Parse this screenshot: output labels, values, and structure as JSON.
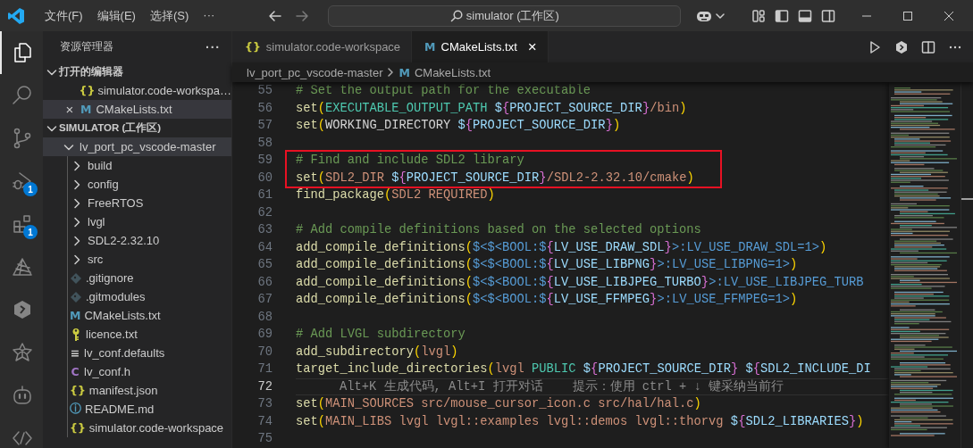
{
  "title_bar": {
    "menu": [
      "文件(F)",
      "编辑(E)",
      "选择(S)",
      "···"
    ],
    "search": {
      "text": "simulator (工作区)"
    }
  },
  "activity_bar": [
    {
      "selected": true
    },
    {
      "selected": false
    },
    {
      "selected": false
    },
    {
      "selected": false,
      "badge": "1"
    },
    {
      "selected": false,
      "badge": "1"
    },
    {
      "selected": false
    },
    {
      "selected": false
    },
    {
      "selected": false
    },
    {
      "selected": false
    },
    {
      "selected": false
    }
  ],
  "explorer": {
    "title": "资源管理器",
    "more": "···",
    "open_editors": {
      "title": "打开的编辑器",
      "expanded": true,
      "items": [
        {
          "glyph": "{}",
          "color": "#cbcb41",
          "label": "simulator.code-workspa…",
          "selected": false
        },
        {
          "close": "×",
          "glyph": "M",
          "color": "#519aba",
          "label": "CMakeLists.txt",
          "selected": true
        }
      ]
    },
    "workspace": {
      "title": "SIMULATOR (工作区)",
      "expanded": true,
      "tree": [
        {
          "kind": "folder",
          "label": "lv_port_pc_vscode-master",
          "expanded": true,
          "highlighted": true,
          "children": [
            {
              "kind": "folder",
              "label": "build",
              "expanded": false,
              "highlighted": false
            },
            {
              "kind": "folder",
              "label": "config",
              "expanded": false,
              "highlighted": false
            },
            {
              "kind": "folder",
              "label": "FreeRTOS",
              "expanded": false,
              "highlighted": false
            },
            {
              "kind": "folder",
              "label": "lvgl",
              "expanded": false,
              "highlighted": false
            },
            {
              "kind": "folder",
              "label": "SDL2-2.32.10",
              "expanded": false,
              "highlighted": false
            },
            {
              "kind": "folder",
              "label": "src",
              "expanded": false,
              "highlighted": false
            },
            {
              "kind": "git_file",
              "label": ".gitignore",
              "highlighted": false
            },
            {
              "kind": "git_file",
              "label": ".gitmodules",
              "highlighted": false
            },
            {
              "kind": "file",
              "glyph": "M",
              "color": "#519aba",
              "label": "CMakeLists.txt",
              "highlighted": false
            },
            {
              "kind": "key_file",
              "label": "licence.txt",
              "highlighted": false
            },
            {
              "kind": "file",
              "glyph": "≡",
              "color": "#cccccc",
              "label": "lv_conf.defaults",
              "highlighted": false
            },
            {
              "kind": "file",
              "glyph": "C",
              "color": "#a074c4",
              "label": "lv_conf.h",
              "highlighted": false
            },
            {
              "kind": "file",
              "glyph": "{}",
              "color": "#cbcb41",
              "label": "manifest.json",
              "highlighted": false
            },
            {
              "kind": "file",
              "glyph": "ⓘ",
              "color": "#519aba",
              "label": "README.md",
              "highlighted": false
            },
            {
              "kind": "file",
              "glyph": "{}",
              "color": "#cbcb41",
              "label": "simulator.code-workspace",
              "highlighted": false
            }
          ]
        }
      ]
    }
  },
  "tabs": [
    {
      "glyph": "{}",
      "color": "#cbcb41",
      "label": "simulator.code-workspace",
      "selected": false
    },
    {
      "glyph": "M",
      "color": "#519aba",
      "label": "CMakeLists.txt",
      "selected": true,
      "close": "×"
    }
  ],
  "breadcrumbs": {
    "folder": "lv_port_pc_vscode-master",
    "file": {
      "glyph": "M",
      "color": "#519aba",
      "label": "CMakeLists.txt"
    }
  },
  "code": {
    "lines": [
      {
        "number": "55",
        "current": false,
        "boxed": false,
        "tokens": [
          {
            "kind": "comment",
            "text": "# Set the output path for the executable"
          }
        ]
      },
      {
        "number": "56",
        "current": false,
        "boxed": false,
        "tokens": [
          {
            "kind": "func",
            "text": "set"
          },
          {
            "kind": "paren",
            "text": "("
          },
          {
            "kind": "const",
            "text": "EXECUTABLE_OUTPUT_PATH"
          },
          {
            "kind": "var",
            "text": " $"
          },
          {
            "kind": "brace",
            "text": "{"
          },
          {
            "kind": "var",
            "text": "PROJECT_SOURCE_DIR"
          },
          {
            "kind": "brace",
            "text": "}"
          },
          {
            "kind": "arg",
            "text": "/bin"
          },
          {
            "kind": "paren",
            "text": ")"
          }
        ]
      },
      {
        "number": "57",
        "current": false,
        "boxed": false,
        "tokens": [
          {
            "kind": "func",
            "text": "set"
          },
          {
            "kind": "paren",
            "text": "("
          },
          {
            "kind": "plain",
            "text": "WORKING_DIRECTORY "
          },
          {
            "kind": "var",
            "text": "$"
          },
          {
            "kind": "brace",
            "text": "{"
          },
          {
            "kind": "var",
            "text": "PROJECT_SOURCE_DIR"
          },
          {
            "kind": "brace",
            "text": "}"
          },
          {
            "kind": "paren",
            "text": ")"
          }
        ]
      },
      {
        "number": "58",
        "current": false,
        "boxed": false
      },
      {
        "number": "59",
        "current": false,
        "boxed": true,
        "tokens": [
          {
            "kind": "comment",
            "text": "# Find and include SDL2 library"
          }
        ]
      },
      {
        "number": "60",
        "current": false,
        "boxed": true,
        "tokens": [
          {
            "kind": "func",
            "text": "set"
          },
          {
            "kind": "paren",
            "text": "("
          },
          {
            "kind": "arg",
            "text": "SDL2_DIR "
          },
          {
            "kind": "var",
            "text": "$"
          },
          {
            "kind": "brace",
            "text": "{"
          },
          {
            "kind": "var",
            "text": "PROJECT_SOURCE_DIR"
          },
          {
            "kind": "brace",
            "text": "}"
          },
          {
            "kind": "arg",
            "text": "/SDL2-2.32.10/cmake"
          },
          {
            "kind": "paren",
            "text": ")"
          }
        ]
      },
      {
        "number": "61",
        "current": false,
        "boxed": false,
        "tokens": [
          {
            "kind": "func",
            "text": "find_package"
          },
          {
            "kind": "paren",
            "text": "("
          },
          {
            "kind": "arg",
            "text": "SDL2 REQUIRED"
          },
          {
            "kind": "paren",
            "text": ")"
          }
        ]
      },
      {
        "number": "62",
        "current": false,
        "boxed": false
      },
      {
        "number": "63",
        "current": false,
        "boxed": false,
        "tokens": [
          {
            "kind": "comment",
            "text": "# Add compile definitions based on the selected options"
          }
        ]
      },
      {
        "number": "64",
        "current": false,
        "boxed": false,
        "tokens": [
          {
            "kind": "func",
            "text": "add_compile_definitions"
          },
          {
            "kind": "paren",
            "text": "("
          },
          {
            "kind": "gen",
            "text": "$<$<BOOL:$"
          },
          {
            "kind": "brace",
            "text": "{"
          },
          {
            "kind": "var",
            "text": "LV_USE_DRAW_SDL"
          },
          {
            "kind": "brace",
            "text": "}"
          },
          {
            "kind": "gen",
            "text": ">:LV_USE_DRAW_SDL=1>"
          },
          {
            "kind": "paren",
            "text": ")"
          }
        ]
      },
      {
        "number": "65",
        "current": false,
        "boxed": false,
        "tokens": [
          {
            "kind": "func",
            "text": "add_compile_definitions"
          },
          {
            "kind": "paren",
            "text": "("
          },
          {
            "kind": "gen",
            "text": "$<$<BOOL:$"
          },
          {
            "kind": "brace",
            "text": "{"
          },
          {
            "kind": "var",
            "text": "LV_USE_LIBPNG"
          },
          {
            "kind": "brace",
            "text": "}"
          },
          {
            "kind": "gen",
            "text": ">:LV_USE_LIBPNG=1>"
          },
          {
            "kind": "paren",
            "text": ")"
          }
        ]
      },
      {
        "number": "66",
        "current": false,
        "boxed": false,
        "tokens": [
          {
            "kind": "func",
            "text": "add_compile_definitions"
          },
          {
            "kind": "paren",
            "text": "("
          },
          {
            "kind": "gen",
            "text": "$<$<BOOL:$"
          },
          {
            "kind": "brace",
            "text": "{"
          },
          {
            "kind": "var",
            "text": "LV_USE_LIBJPEG_TURBO"
          },
          {
            "kind": "brace",
            "text": "}"
          },
          {
            "kind": "gen",
            "text": ">:LV_USE_LIBJPEG_TURB"
          }
        ]
      },
      {
        "number": "67",
        "current": false,
        "boxed": false,
        "tokens": [
          {
            "kind": "func",
            "text": "add_compile_definitions"
          },
          {
            "kind": "paren",
            "text": "("
          },
          {
            "kind": "gen",
            "text": "$<$<BOOL:$"
          },
          {
            "kind": "brace",
            "text": "{"
          },
          {
            "kind": "var",
            "text": "LV_USE_FFMPEG"
          },
          {
            "kind": "brace",
            "text": "}"
          },
          {
            "kind": "gen",
            "text": ">:LV_USE_FFMPEG=1>"
          },
          {
            "kind": "paren",
            "text": ")"
          }
        ]
      },
      {
        "number": "68",
        "current": false,
        "boxed": false
      },
      {
        "number": "69",
        "current": false,
        "boxed": false,
        "tokens": [
          {
            "kind": "comment",
            "text": "# Add LVGL subdirectory"
          }
        ]
      },
      {
        "number": "70",
        "current": false,
        "boxed": false,
        "tokens": [
          {
            "kind": "func",
            "text": "add_subdirectory"
          },
          {
            "kind": "paren",
            "text": "("
          },
          {
            "kind": "arg",
            "text": "lvgl"
          },
          {
            "kind": "paren",
            "text": ")"
          }
        ]
      },
      {
        "number": "71",
        "current": false,
        "boxed": false,
        "tokens": [
          {
            "kind": "func",
            "text": "target_include_directories"
          },
          {
            "kind": "paren",
            "text": "("
          },
          {
            "kind": "arg",
            "text": "lvgl "
          },
          {
            "kind": "const",
            "text": "PUBLIC"
          },
          {
            "kind": "var",
            "text": " $"
          },
          {
            "kind": "brace",
            "text": "{"
          },
          {
            "kind": "var",
            "text": "PROJECT_SOURCE_DIR"
          },
          {
            "kind": "brace",
            "text": "}"
          },
          {
            "kind": "var",
            "text": " $"
          },
          {
            "kind": "brace",
            "text": "{"
          },
          {
            "kind": "var",
            "text": "SDL2_INCLUDE_DI"
          }
        ]
      },
      {
        "number": "72",
        "current": true,
        "boxed": false,
        "tokens": [
          {
            "kind": "hint",
            "text": "Alt+K 生成代码, Alt+I 打开对话    提示：使用 ctrl + ↓ 键采纳当前行"
          }
        ]
      },
      {
        "number": "73",
        "current": false,
        "boxed": false,
        "tokens": [
          {
            "kind": "func",
            "text": "set"
          },
          {
            "kind": "paren",
            "text": "("
          },
          {
            "kind": "arg",
            "text": "MAIN_SOURCES src/mouse_cursor_icon.c src/hal/hal.c"
          },
          {
            "kind": "paren",
            "text": ")"
          }
        ]
      },
      {
        "number": "74",
        "current": false,
        "boxed": false,
        "tokens": [
          {
            "kind": "func",
            "text": "set"
          },
          {
            "kind": "paren",
            "text": "("
          },
          {
            "kind": "arg",
            "text": "MAIN_LIBS lvgl lvgl::examples lvgl::demos lvgl::thorvg "
          },
          {
            "kind": "var",
            "text": "$"
          },
          {
            "kind": "brace",
            "text": "{"
          },
          {
            "kind": "var",
            "text": "SDL2_LIBRARIES"
          },
          {
            "kind": "brace",
            "text": "}"
          },
          {
            "kind": "paren",
            "text": ")"
          }
        ]
      },
      {
        "number": "75",
        "current": false,
        "boxed": false
      }
    ]
  }
}
